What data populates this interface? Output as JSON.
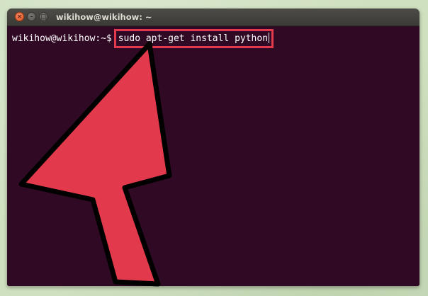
{
  "window": {
    "title": "wikihow@wikihow: ~"
  },
  "terminal": {
    "prompt": "wikihow@wikihow:~$ ",
    "command": "sudo apt-get install python"
  },
  "titlebar_buttons": {
    "close": "×",
    "minimize": "–",
    "maximize": "□"
  },
  "colors": {
    "terminal_bg": "#300a24",
    "highlight": "#e23a4c",
    "arrow": "#e23a4c",
    "page_bg": "#cfe0bf"
  },
  "icons": {
    "arrow": "pointer-arrow-icon"
  }
}
